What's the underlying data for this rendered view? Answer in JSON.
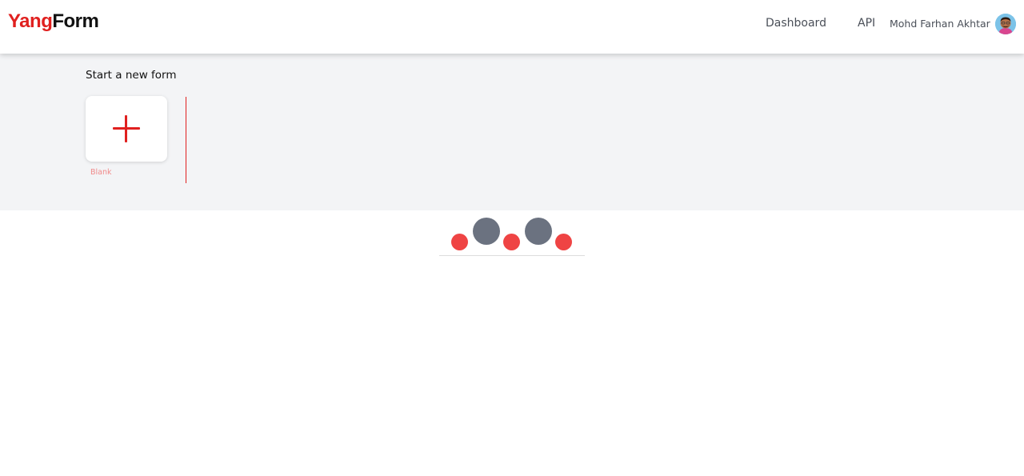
{
  "header": {
    "logo_part1": "Yang",
    "logo_part2": "Form",
    "nav": {
      "dashboard": "Dashboard",
      "api": "API"
    },
    "user_name": "Mohd Farhan Akhtar"
  },
  "gallery": {
    "title": "Start a new form",
    "blank_label": "Blank"
  },
  "colors": {
    "brand_red": "#e0201f",
    "loader_red": "#ef4444",
    "loader_gray": "#6b7280",
    "gallery_bg": "#f3f4f6"
  },
  "icons": [
    "plus-icon",
    "avatar"
  ]
}
